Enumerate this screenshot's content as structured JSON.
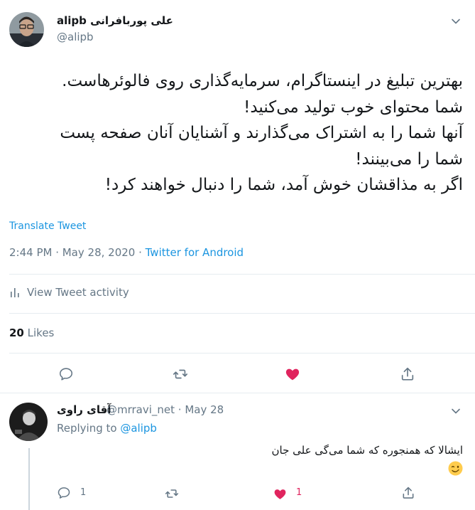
{
  "tweet": {
    "display_name": "alipb علی پوربافرانی",
    "handle": "@alipb",
    "text_lines": [
      "بهترین تبلیغ در اینستاگرام، سرمایه‌گذاری روی فالوئرهاست.",
      "شما محتوای خوب تولید می‌کنید!",
      "آنها شما را به اشتراک می‌گذارند و آشنایان آنان صفحه پست",
      "شما را می‌بینند!",
      "اگر به مذاقشان خوش آمد، شما را دنبال خواهند کرد!"
    ],
    "translate_label": "Translate Tweet",
    "time": "2:44 PM · May 28, 2020 · ",
    "source": "Twitter for Android",
    "activity_label": "View Tweet activity",
    "likes_count": "20",
    "likes_label": " Likes"
  },
  "reply": {
    "display_name": "آقای راوی",
    "meta": "@mrravi_net · May 28",
    "replying_prefix": "Replying to ",
    "replying_to": "@alipb",
    "text": "ایشالا که همنجوره که شما می‌گی علی جان",
    "emoji": "wink-emoji",
    "reply_count": "1",
    "like_count": "1"
  },
  "colors": {
    "link": "#1b95e0",
    "secondary": "#657786",
    "like_red": "#e0245e",
    "divider": "#e6ecf0"
  },
  "icons": [
    "caret-down-icon",
    "bar-chart-icon",
    "reply-icon",
    "retweet-icon",
    "heart-icon",
    "share-icon"
  ]
}
